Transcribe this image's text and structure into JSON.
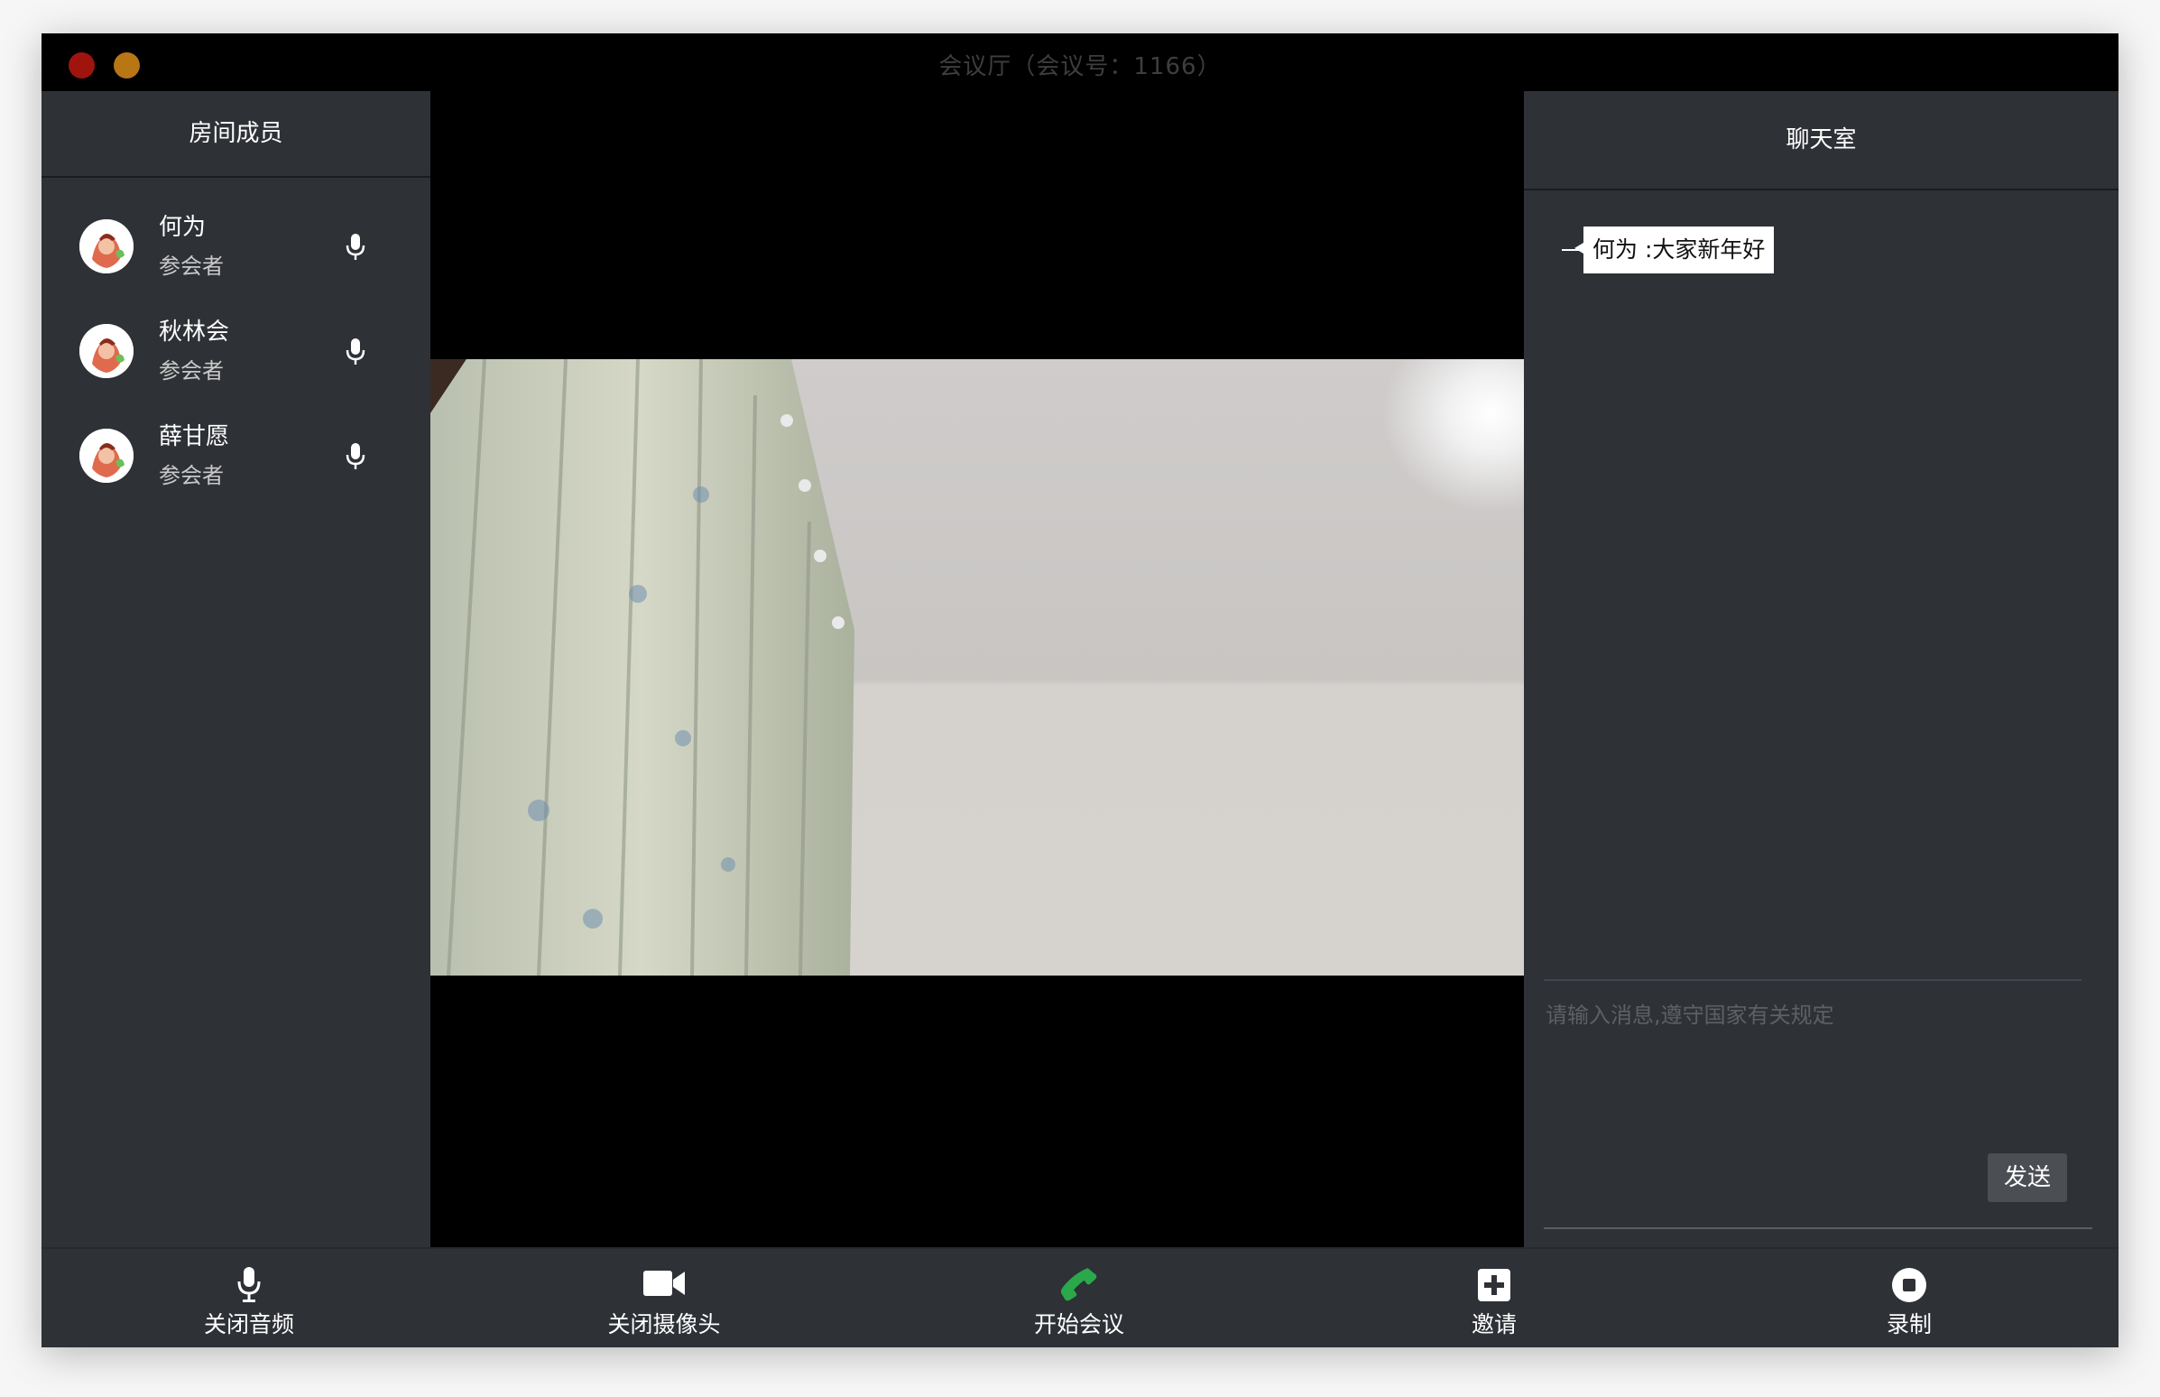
{
  "window": {
    "title": "会议厅（会议号：1166）"
  },
  "members": {
    "header": "房间成员",
    "items": [
      {
        "name": "何为",
        "role": "参会者"
      },
      {
        "name": "秋林会",
        "role": "参会者"
      },
      {
        "name": "薛甘愿",
        "role": "参会者"
      }
    ]
  },
  "chat": {
    "header": "聊天室",
    "messages": [
      {
        "text": "何为 :大家新年好"
      }
    ],
    "input_placeholder": "请输入消息,遵守国家有关规定",
    "send_label": "发送"
  },
  "toolbar": {
    "mute_audio": "关闭音频",
    "close_camera": "关闭摄像头",
    "start_meeting": "开始会议",
    "invite": "邀请",
    "record": "录制"
  },
  "colors": {
    "panel_bg": "#2e3136",
    "call_green": "#2aa84a",
    "close_red": "#a0140e",
    "minimize_yellow": "#b97614"
  }
}
